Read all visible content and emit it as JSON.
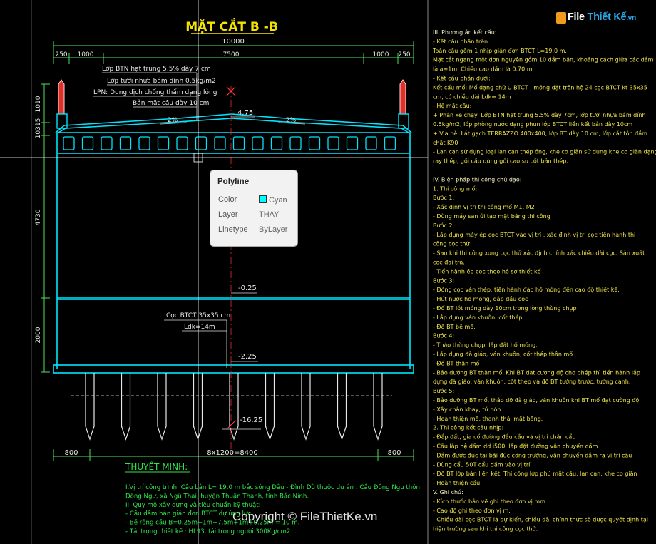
{
  "drawing": {
    "title": "MẶT CẮT B -B",
    "dims_top": {
      "total": "10000",
      "d1": "250",
      "d2": "1000",
      "d3": "7500",
      "d4": "1000",
      "d5": "250"
    },
    "dims_left": {
      "h1": "1010",
      "h2": "10315",
      "h3": "4730",
      "h4": "2000"
    },
    "dims_bottom": {
      "b1": "800",
      "b2": "8x1200=8400",
      "b3": "800"
    },
    "layers": [
      "Lớp BTN hạt trung 5.5% dày 7 cm",
      "Lớp tưới nhựa bám dính 0.5kg/m2",
      "LPN: Dung dịch chống thấm dạng lỏng",
      "Bản mặt cầu dày 10 cm"
    ],
    "slope_left": "2%",
    "slope_right": "2%",
    "elev_top": "4.75",
    "elev_mid": "-0.25",
    "elev_base": "-2.25",
    "elev_pile": "-16.25",
    "pile_label": "Cọc BTCT 35x35 cm",
    "pile_length": "Ldk=14m"
  },
  "properties_popup": {
    "title": "Polyline",
    "rows": [
      {
        "label": "Color",
        "value": "Cyan",
        "swatch": "#00ffff"
      },
      {
        "label": "Layer",
        "value": "THAY"
      },
      {
        "label": "Linetype",
        "value": "ByLayer"
      }
    ]
  },
  "notes": {
    "lines": [
      "III. Phương án kết cấu:",
      " - Kết cấu phần trên:",
      "   Toàn cầu gồm 1 nhịp giản đơn BTCT  L=19.0 m.",
      "   Mặt cắt ngang một đơn nguyên gồm 10 dầm bản, khoảng cách giữa các dầm",
      "là a=1m. Chiều cao dầm là 0.70 m",
      " - Kết cấu phần dưới:",
      "   Kết cấu mố: Mố dạng chữ U BTCT , móng đặt trên hệ 24 cọc BTCT kt 35x35",
      "cm, có chiều dài Ldk= 14m",
      " - Hệ mặt cầu:",
      "   + Phần xe chạy: Lớp BTN hạt trung 5.5% dày 7cm, lớp tưới nhựa bám dính",
      "0.5kg/m2, lớp phòng nước dạng phun lớp BTCT liền kết bản  dày 10cm",
      "   + Via hè: Lát gạch TERRAZZO 400x400, lớp BT dày 10 cm, lớp cát tôn đầm",
      "chặt K90",
      " - Lan can sử dụng loại lan can thép ống, khe co giãn sử dụng khe co giãn dạng",
      "ray thép, gối cầu dùng gối cao su cốt bản thép.",
      "",
      "IV. Biện pháp thi công chủ đạo:",
      " 1. Thi công mố:",
      "   Bước 1:",
      "          - Xác định vị trí thi công mố M1, M2",
      "          - Dùng máy san ủi tạo mặt bằng thi công",
      "   Bước 2:",
      "          - Lắp dựng máy ép cọc BTCT vào vị trí , xác định vị trí cọc tiến hành thi",
      "công cọc thử",
      "          - Sau khi thi công xong cọc thử xác định chính xác chiều dài cọc. Sản xuất",
      "cọc đại trà.",
      "          - Tiến hành ép cọc theo hồ sơ thiết kế",
      "   Bước 3:",
      "          - Đóng cọc ván thép, tiến hành đào hố móng đến cao độ thiết kế.",
      "          - Hút nước hố móng, đập đầu cọc",
      "          - Đổ BT lót móng dày 10cm trong lòng thùng chụp",
      "          - Lắp dựng ván khuôn, cốt thép",
      "          - Đổ BT bệ mố.",
      "  Bước 4:",
      "          - Tháo thùng chụp, lắp đất hố móng.",
      "          - Lắp dựng đà giáo, ván khuôn, cốt thép thân mố",
      "          - Đổ BT thân mố",
      "          - Bảo dưỡng BT thân mố. Khi BT đạt cường độ cho phép thì tiến hành lắp",
      "dựng đà giáo, ván khuôn, cốt thép và đổ BT tường trước, tường cánh.",
      "   Bước 5:",
      "          - Bảo dưỡng BT mố, tháo dỡ đà giáo, ván khuôn khi BT mố đạt cường độ",
      "          - Xây chân khay, tứ nón",
      "          - Hoàn thiện mố, thanh thải mặt bằng.",
      " 2. Thi công kết cấu nhịp:",
      "          - Đắp đất, gia  cố đường đầu cầu và vị trí chân cẩu",
      "          - Cẩu lắp hệ dầm dd i500, lắp đặt đường vận chuyển dầm",
      "          - Dầm được đúc tại bãi đúc công trường, vận chuyển dầm ra vị trí cầu",
      "          - Dùng cẩu 50T cẩu dầm vào vị trí",
      "          - Đổ BT lớp bản liền kết. Thi công lớp phủ mặt cầu, lan can, khe co giãn",
      "          - Hoàn thiện cầu.",
      " V. Ghi chú:",
      "  - Kích thước bản vẽ ghi theo đơn vị mm",
      "  - Cao độ ghi theo đơn vị m.",
      "  - Chiều dài cọc BTCT là dự kiến, chiều dài chính thức sẽ được quyết định tại",
      "hiện trường sau khi thi công cọc thử."
    ]
  },
  "thuyet_minh": {
    "heading": "THUYẾT MINH:",
    "lines": [
      "I.Vị trí công trình: Cầu bản L= 19.0 m bắc sông Dâu - Đình Dù thuộc dự án : Cầu Đông Ngư thôn",
      "Đông Ngư, xã Ngũ Thái, huyện Thuận Thành, tỉnh Bắc Ninh.",
      "II. Quy mô xây dựng và tiêu chuẩn kỹ thuật:",
      "  - Cầu dầm bản giản đơn BTCT dự ứng lực",
      "  - Bề rộng cầu B=0.25m+1m+7.5m+1m+0.25m =  10 m.",
      "  - Tải trọng thiết kế : HL93, tải trọng  người 300Kg/cm2"
    ]
  },
  "logo": {
    "file": "File",
    "rest": "Thiết Kế",
    "tld": ".vn"
  },
  "watermark": "Copyright © FileThietKe.vn"
}
